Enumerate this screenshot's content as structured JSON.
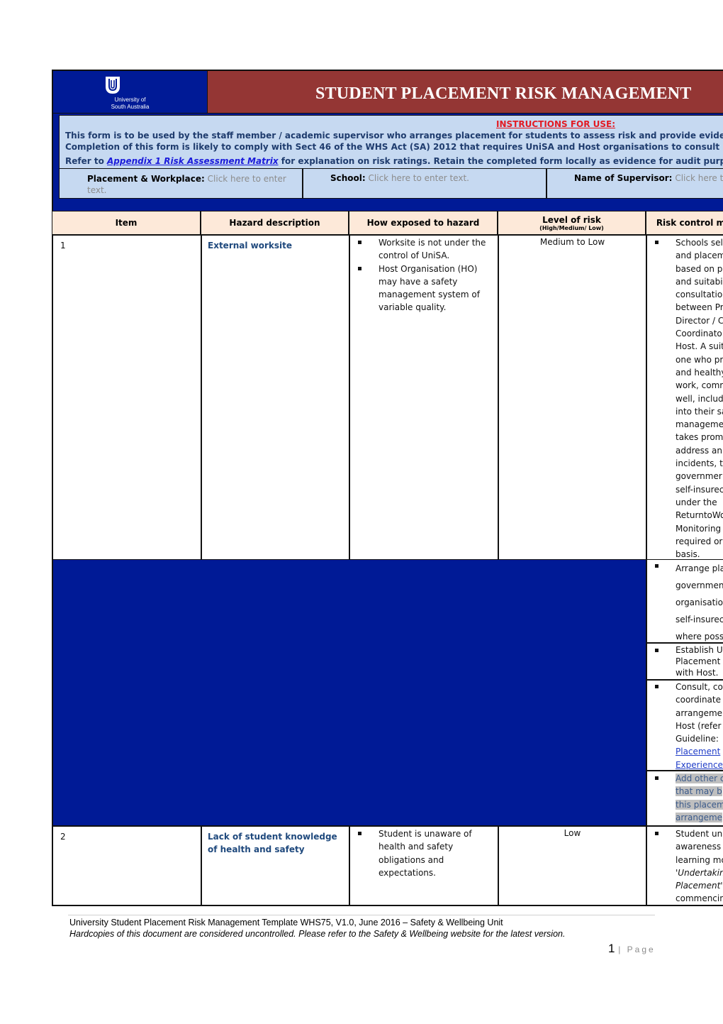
{
  "header": {
    "logo_line1": "University of",
    "logo_line2": "South Australia",
    "title": "STUDENT PLACEMENT RISK MANAGEMENT"
  },
  "instructions": {
    "heading": "INSTRUCTIONS FOR USE:",
    "line1": "This form is to be used by the staff member / academic supervisor who arranges placement for students to assess risk and provide evidence",
    "line2": "Completion of this form is likely to comply with Sect 46 of the WHS Act (SA) 2012 that requires UniSA and Host organisations to consult",
    "line3_prefix": "Refer to ",
    "line3_link": "Appendix 1 Risk Assessment Matrix",
    "line3_suffix": " for explanation on risk ratings.   Retain the completed form locally as evidence for audit purposes."
  },
  "fields": [
    {
      "label": "Placement & Workplace:",
      "value": "Click here to enter text."
    },
    {
      "label": "School:",
      "value": "Click here to enter text."
    },
    {
      "label": "Name of Supervisor:",
      "value": "Click here to enter text."
    }
  ],
  "table": {
    "headers": {
      "item": "Item",
      "hazard": "Hazard description",
      "exposure": "How exposed to hazard",
      "level": "Level of risk",
      "level_sub": "(High/Medium/ Low)",
      "control": "Risk control measures"
    },
    "rows": [
      {
        "item": "1",
        "hazard": "External worksite",
        "exposure": [
          "Worksite is not under the control of UniSA.",
          "Host Organisation (HO) may have a safety management system of variable quality."
        ],
        "level": "Medium to Low",
        "controls": [
          "Schools select and placement based on p and suitabi consultatio between Pr Director / C Coordinato Host. A suit one who pr and healthy work, comr well, includ into their sa manageme takes prom address an incidents, t governmer self-insurec under the ReturntoWo Monitoring required or basis.",
          "Arrange pla governmen organisatio self-insurec where poss",
          "Establish U Placement with Host.",
          "Consult, co coordinate arrangeme Host (refer Guideline: Placement Experience",
          "Add other c that may b this placem arrangeme"
        ]
      },
      {
        "item": "2",
        "hazard": "Lack of student knowledge of health and safety",
        "exposure": [
          "Student is unaware of health and safety obligations and expectations."
        ],
        "level": "Low",
        "controls": [
          "Student un awareness learning mo 'Undertakin Placement' commencin"
        ]
      }
    ],
    "control_lines": {
      "c1": [
        "Schools sel",
        "and placem",
        "based on p",
        "and suitabi",
        "consultatio",
        "between Pr",
        "Director / C",
        "Coordinato",
        "Host. A suit",
        "one who pr",
        "and healthy",
        "work, comr",
        "well, includ",
        "into their sa",
        "manageme",
        "takes prom",
        "address an",
        "incidents, t",
        "governmer",
        "self-insurec",
        "under the",
        "ReturntoWo",
        "Monitoring",
        "required or",
        "basis."
      ],
      "c2": [
        "Arrange pla",
        "governmen",
        "organisatio",
        "self-insurec",
        "where poss"
      ],
      "c3": [
        "Establish U",
        "Placement",
        "with Host."
      ],
      "c4_plain": [
        "Consult, co",
        "coordinate",
        "arrangeme",
        "Host (refer",
        "Guideline: "
      ],
      "c4_link": [
        "Placement",
        "Experience"
      ],
      "c5": [
        "Add other c",
        "that may b",
        "this placem",
        "arrangeme"
      ],
      "r2": [
        "Student un",
        "awareness",
        "learning mo",
        "'Undertakin",
        "Placement'",
        "commencin"
      ]
    }
  },
  "footer": {
    "line1": "University Student Placement Risk Management Template WHS75, V1.0, June 2016 – Safety & Wellbeing Unit",
    "line2": "Hardcopies of this document are considered uncontrolled.  Please refer to the Safety & Wellbeing website for the latest version.",
    "page_number": "1",
    "page_label": "| Page"
  }
}
